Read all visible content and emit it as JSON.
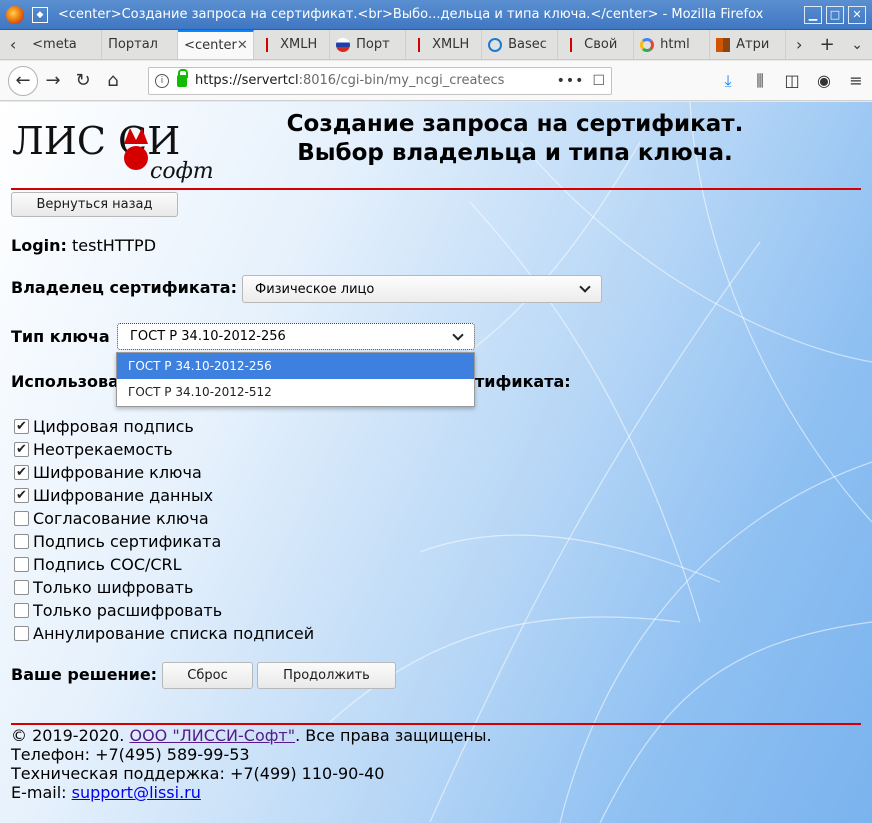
{
  "window": {
    "title": "<center>Создание запроса на сертификат.<br>Выбо...дельца и типа ключа.</center> - Mozilla Firefox"
  },
  "tabs": [
    {
      "label": "<meta",
      "icon": "none",
      "active": false
    },
    {
      "label": "Портал",
      "icon": "none",
      "active": false
    },
    {
      "label": "<center",
      "icon": "none",
      "active": true
    },
    {
      "label": "XMLH",
      "icon": "red-tower-icon",
      "active": false
    },
    {
      "label": "Порт",
      "icon": "russia-flag-icon",
      "active": false
    },
    {
      "label": "XMLH",
      "icon": "red-tower-icon",
      "active": false
    },
    {
      "label": "Basec",
      "icon": "share-icon",
      "active": false
    },
    {
      "label": "Свой",
      "icon": "red-tower-icon",
      "active": false
    },
    {
      "label": "html",
      "icon": "google-icon",
      "active": false
    },
    {
      "label": "Атри",
      "icon": "color-blocks-icon",
      "active": false
    }
  ],
  "navbar": {
    "url_host": "https://servertcl",
    "url_rest": ":8016/cgi-bin/my_ncgi_createcs",
    "more": "•••"
  },
  "page": {
    "logo_text_main": "ЛИС СИ",
    "logo_text_sub": "софт",
    "title_line1": "Создание запроса на сертификат.",
    "title_line2": "Выбор владельца и типа ключа.",
    "back_button": "Вернуться назад",
    "login_label": "Login:",
    "login_value": "testHTTPD",
    "owner_label": "Владелец сертификата:",
    "owner_value": "Физическое лицо",
    "key_type_label": "Тип ключа",
    "key_type_value": "ГОСТ Р 34.10-2012-256",
    "key_type_options": [
      "ГОСТ Р 34.10-2012-256",
      "ГОСТ Р 34.10-2012-512"
    ],
    "usage_label_left": "Использова",
    "usage_label_right": "тификата:",
    "usages": [
      {
        "label": "Цифровая подпись",
        "checked": true
      },
      {
        "label": "Неотрекаемость",
        "checked": true
      },
      {
        "label": "Шифрование ключа",
        "checked": true
      },
      {
        "label": "Шифрование данных",
        "checked": true
      },
      {
        "label": "Согласование ключа",
        "checked": false
      },
      {
        "label": "Подпись сертификата",
        "checked": false
      },
      {
        "label": "Подпись СОС/CRL",
        "checked": false
      },
      {
        "label": "Только шифровать",
        "checked": false
      },
      {
        "label": "Только расшифровать",
        "checked": false
      },
      {
        "label": "Аннулирование списка подписей",
        "checked": false
      }
    ],
    "decision_label": "Ваше решение:",
    "reset_button": "Сброс",
    "continue_button": "Продолжить"
  },
  "footer": {
    "copyright_prefix": "© 2019-2020. ",
    "company_link": "ООО \"ЛИССИ-Софт\"",
    "copyright_suffix": ". Все права защищены.",
    "phone": "Телефон: +7(495) 589-99-53",
    "support": "Техническая поддержка: +7(499) 110-90-40",
    "email_label": "E-mail: ",
    "email": "support@lissi.ru"
  },
  "colors": {
    "accent_red": "#d40000",
    "selected_option": "#3d80df",
    "link": "#0000ee",
    "link_visited": "#551a8b"
  }
}
